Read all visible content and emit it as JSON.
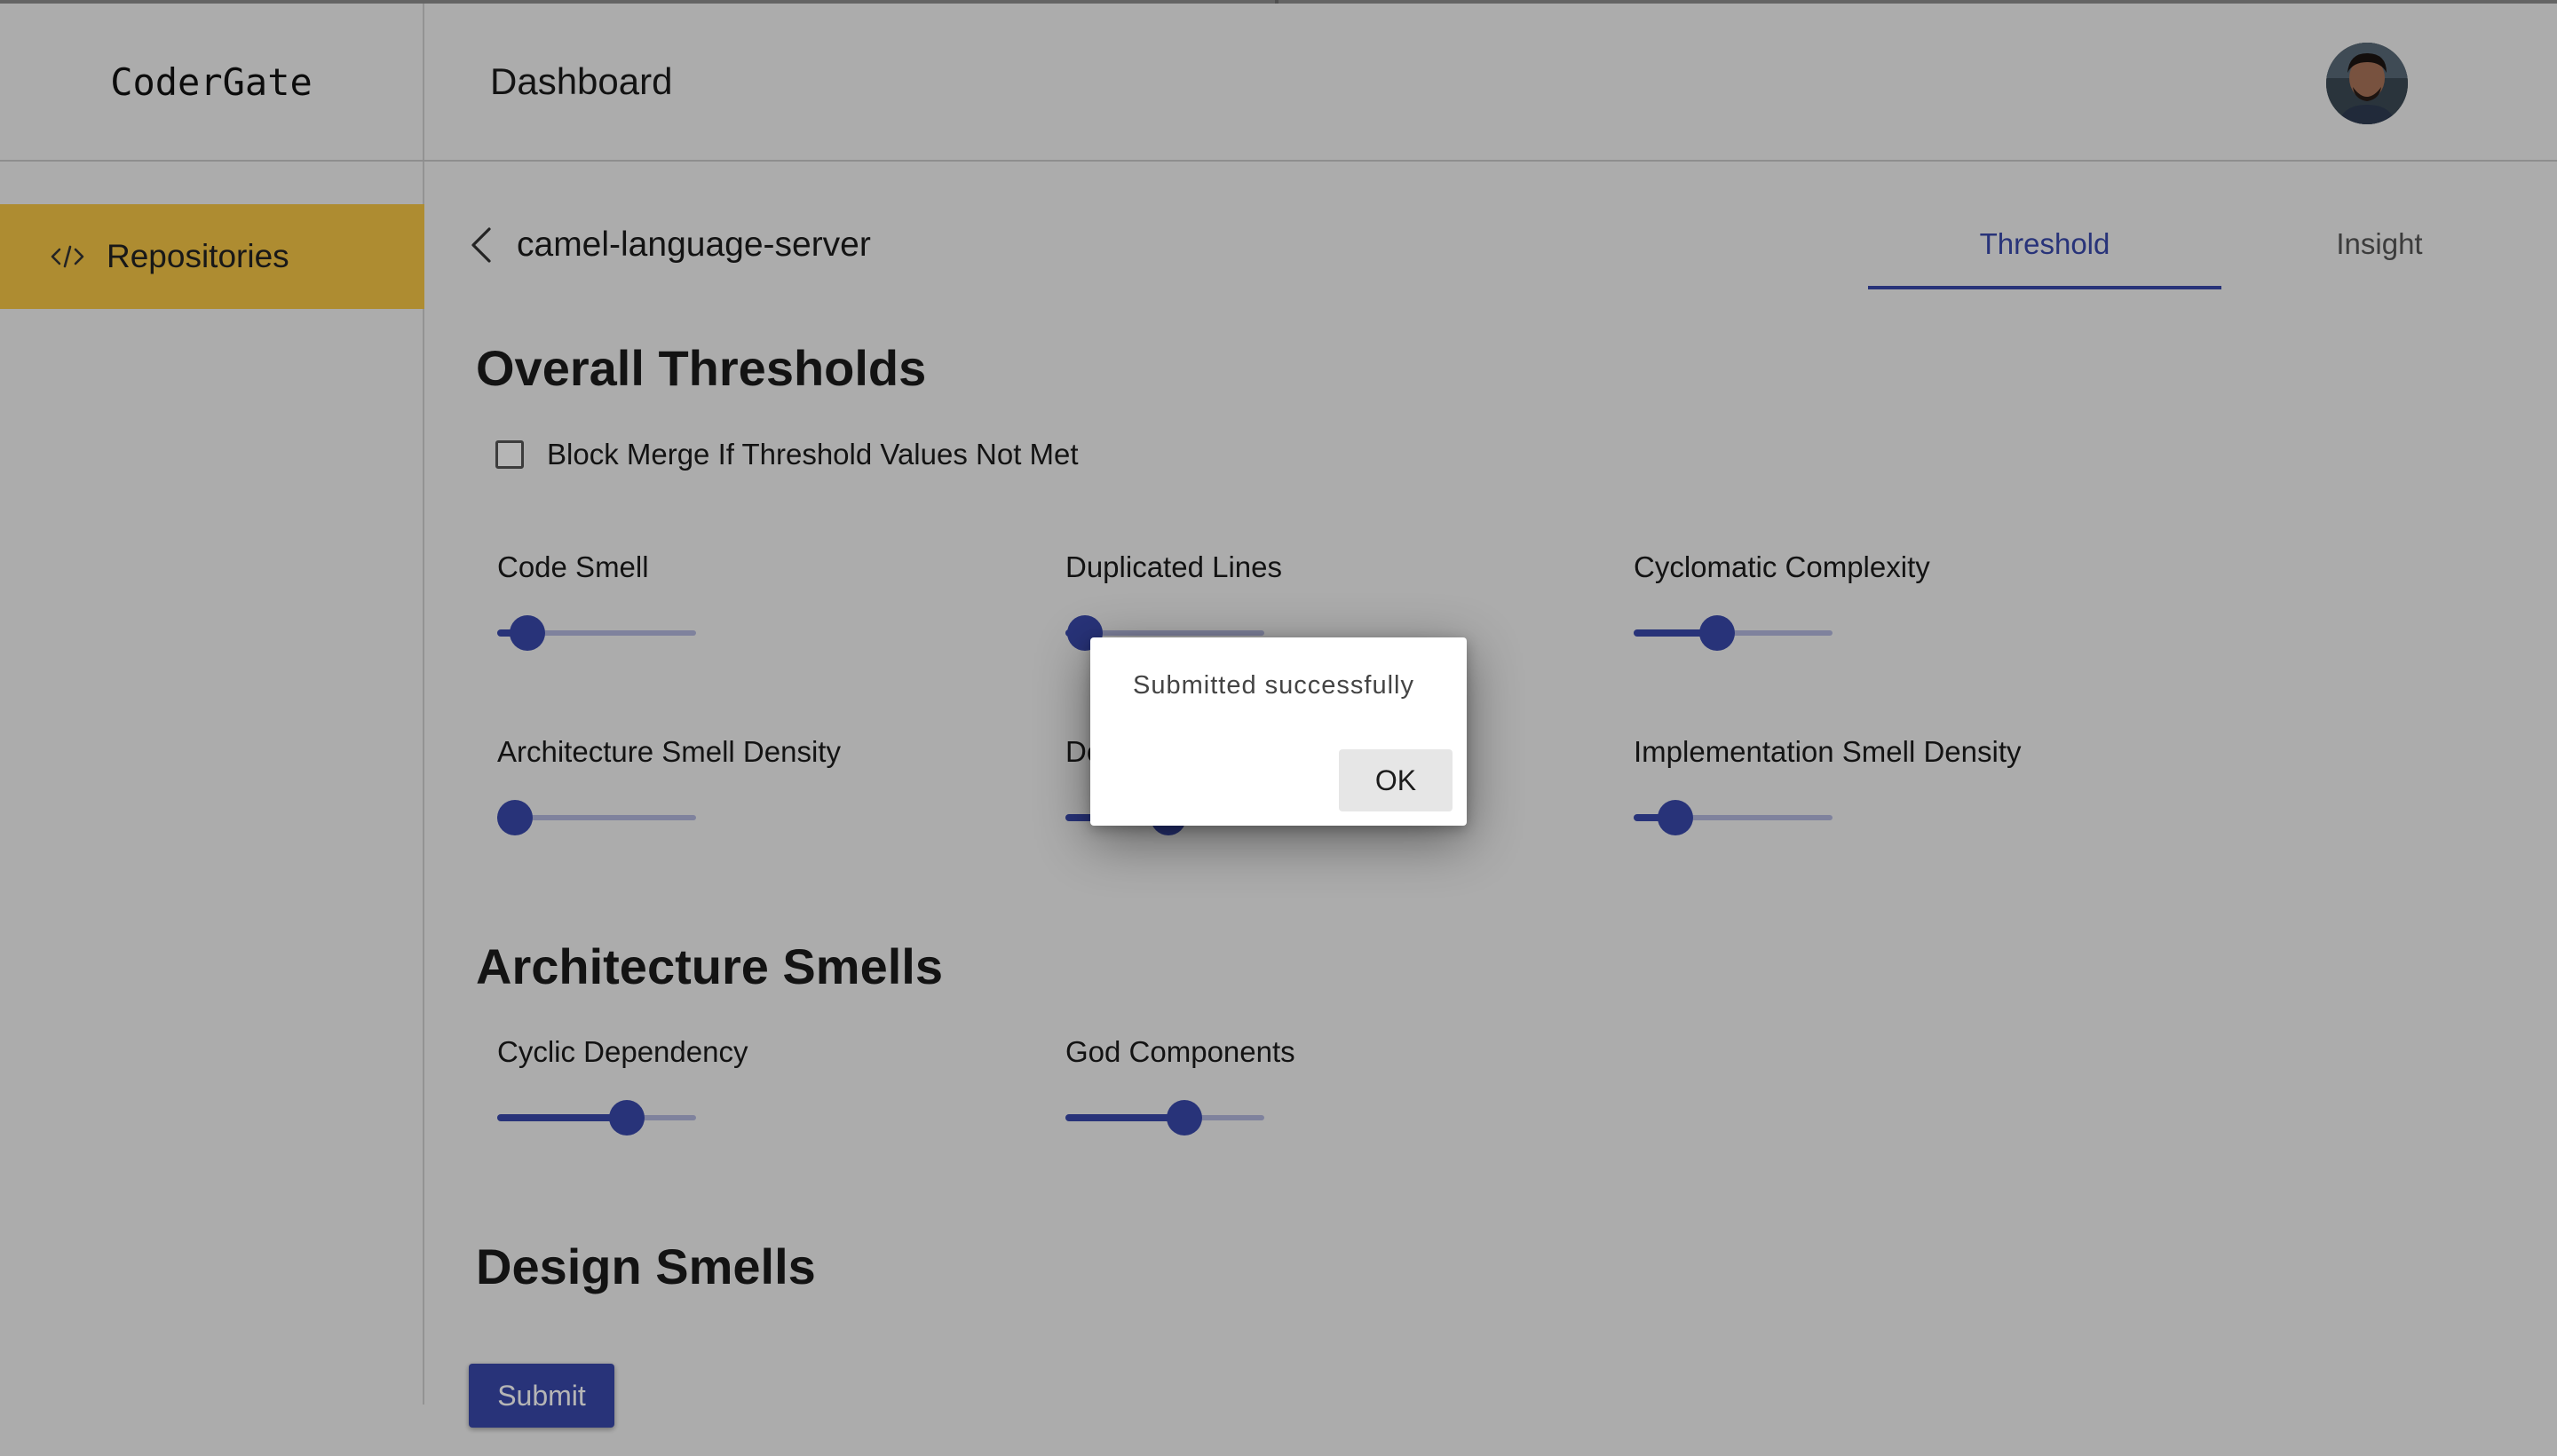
{
  "header": {
    "brand": "CoderGate",
    "title": "Dashboard",
    "avatar_icon": "user-avatar"
  },
  "sidebar": {
    "items": [
      {
        "label": "Repositories",
        "icon": "code-icon",
        "active": true
      }
    ]
  },
  "repo": {
    "name": "camel-language-server"
  },
  "tabs": [
    {
      "label": "Threshold",
      "active": true
    },
    {
      "label": "Insight",
      "active": false
    }
  ],
  "sections": {
    "overall": "Overall Thresholds",
    "architecture": "Architecture Smells",
    "design": "Design Smells"
  },
  "block_merge": {
    "label": "Block Merge If Threshold Values Not Met",
    "checked": false
  },
  "overall_metrics": [
    {
      "label": "Code Smell",
      "value": 0.15
    },
    {
      "label": "Duplicated Lines",
      "value": 0.1
    },
    {
      "label": "Cyclomatic Complexity",
      "value": 0.42
    },
    {
      "label": "Architecture Smell Density",
      "value": 0.09
    },
    {
      "label": "De",
      "value": 0.52
    },
    {
      "label": "Implementation Smell Density",
      "value": 0.21
    }
  ],
  "architecture_metrics": [
    {
      "label": "Cyclic Dependency",
      "value": 0.65
    },
    {
      "label": "God Components",
      "value": 0.6
    }
  ],
  "submit_label": "Submit",
  "dialog": {
    "message": "Submitted successfully",
    "ok_label": "OK"
  },
  "colors": {
    "accent": "#3949ab",
    "sidebar_active": "#f5c646",
    "overlay": "rgba(0,0,0,0.29)"
  }
}
